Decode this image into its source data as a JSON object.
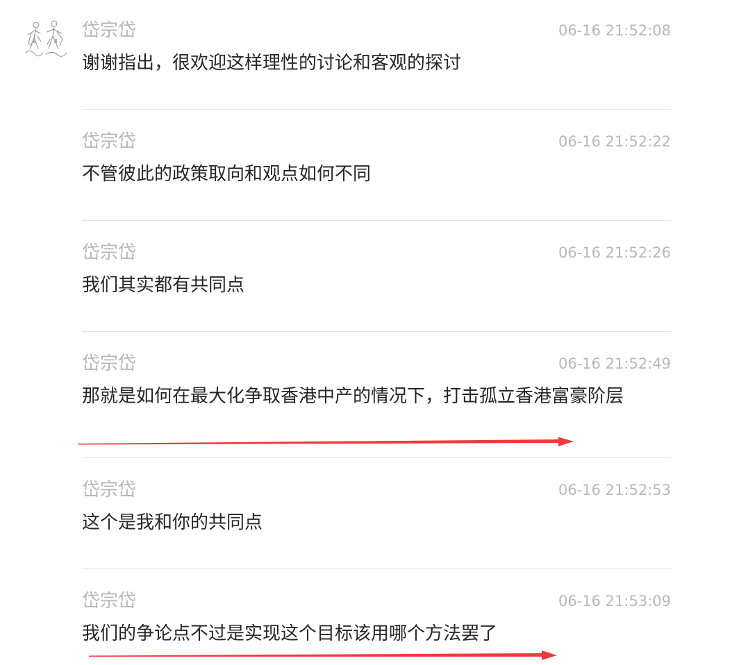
{
  "messages": [
    {
      "author": "岱宗岱",
      "time": "06-16 21:52:08",
      "text": "谢谢指出，很欢迎这样理性的讨论和客观的探讨"
    },
    {
      "author": "岱宗岱",
      "time": "06-16 21:52:22",
      "text": "不管彼此的政策取向和观点如何不同"
    },
    {
      "author": "岱宗岱",
      "time": "06-16 21:52:26",
      "text": "我们其实都有共同点"
    },
    {
      "author": "岱宗岱",
      "time": "06-16 21:52:49",
      "text": "那就是如何在最大化争取香港中产的情况下，打击孤立香港富豪阶层"
    },
    {
      "author": "岱宗岱",
      "time": "06-16 21:52:53",
      "text": "这个是我和你的共同点"
    },
    {
      "author": "岱宗岱",
      "time": "06-16 21:53:09",
      "text": "我们的争论点不过是实现这个目标该用哪个方法罢了"
    }
  ],
  "colors": {
    "meta_text": "#b8b8b8",
    "body_text": "#262626",
    "divider": "#e4e4e4",
    "annotation_arrow": "#f03a3a"
  },
  "icons": {
    "avatar": "sketch-figures-avatar-icon",
    "annotation": "red-arrow-icon"
  }
}
